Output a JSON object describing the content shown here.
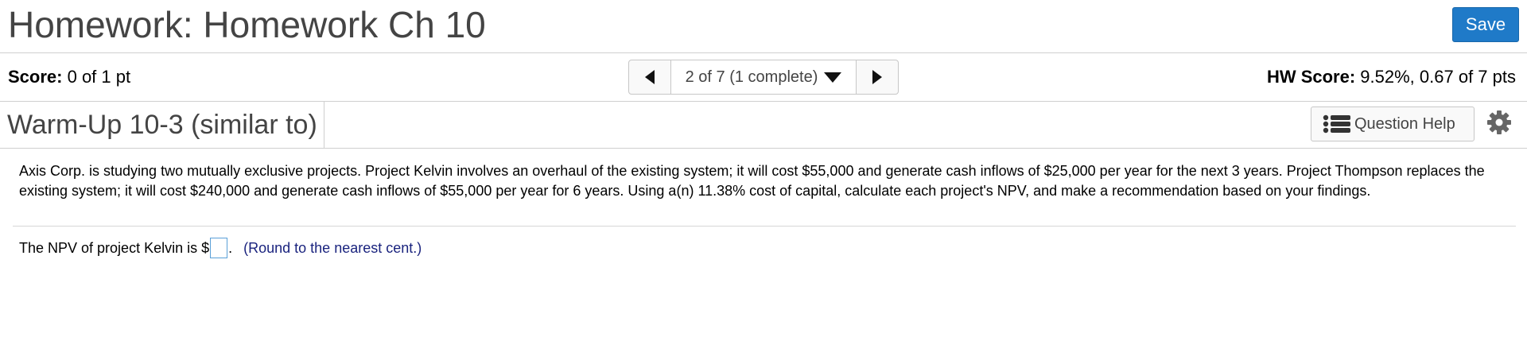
{
  "header": {
    "title": "Homework: Homework Ch 10",
    "save_label": "Save"
  },
  "scorebar": {
    "score_label": "Score:",
    "score_value": " 0 of 1 pt",
    "nav_position": "2 of 7 (1 complete)",
    "hw_score_label": "HW Score:",
    "hw_score_value": " 9.52%, 0.67 of 7 pts"
  },
  "question": {
    "title": "Warm-Up 10-3 (similar to)",
    "help_label": "Question Help",
    "problem_text": "Axis Corp. is studying two mutually exclusive projects.  Project Kelvin involves an overhaul of the existing system; it will cost $55,000 and generate cash inflows of $25,000 per year for the next 3 years.  Project Thompson  replaces the existing system; it will cost $240,000 and generate cash inflows of $55,000 per year for 6 years.  Using a(n) 11.38% cost of capital, calculate each project's NPV, and make a recommendation based on your findings.",
    "answer_prefix": "The NPV of project Kelvin is $",
    "answer_value": "",
    "answer_suffix": ".",
    "hint": "(Round to the nearest cent.)"
  },
  "icons": {
    "prev": "triangle-left-icon",
    "next": "triangle-right-icon",
    "dropdown": "triangle-down-icon",
    "help": "list-icon",
    "settings": "gear-icon"
  },
  "colors": {
    "save_button": "#1f7ac8",
    "hint_text": "#1a237e",
    "input_border": "#5aa0d8"
  }
}
